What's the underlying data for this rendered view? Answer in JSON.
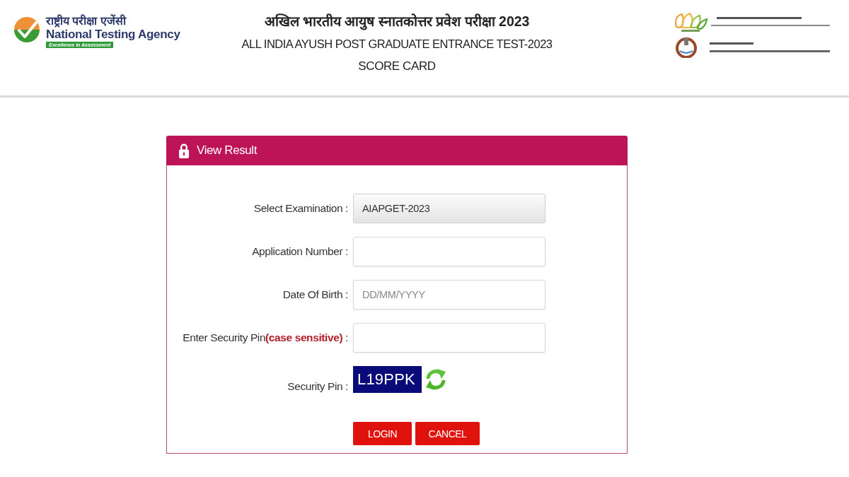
{
  "header": {
    "logo": {
      "hindi": "राष्ट्रीय परीक्षा एजेंसी",
      "name": "National Testing Agency",
      "tagline": "Excellence in Assessment"
    },
    "title": {
      "hindi": "अखिल भारतीय आयुष स्नातकोत्तर प्रवेश परीक्षा 2023",
      "english": "ALL INDIA AYUSH POST GRADUATE ENTRANCE TEST-2023",
      "subtitle": "SCORE CARD"
    }
  },
  "panel": {
    "title": "View Result",
    "rows": [
      {
        "kind": "select",
        "label": "Select Examination :",
        "value": "AIAPGET-2023"
      },
      {
        "kind": "text",
        "label": "Application Number :"
      },
      {
        "kind": "text",
        "label": "Date Of Birth :",
        "placeholder": "DD/MM/YYYY"
      },
      {
        "kind": "text",
        "label": "Enter Security Pin**(case sensitive)** :"
      },
      {
        "kind": "captcha",
        "label": "Security Pin :",
        "code": "L19PPK"
      }
    ],
    "buttons": [
      "LOGIN",
      "CANCEL"
    ]
  }
}
